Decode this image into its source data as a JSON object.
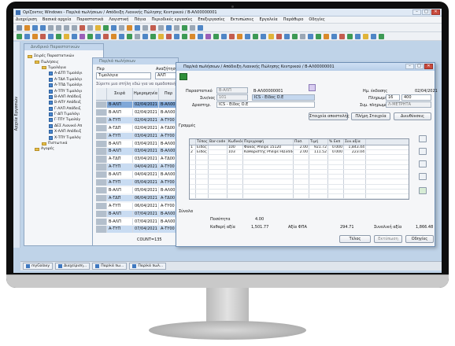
{
  "window": {
    "title": "Ορίζοντες Windows - Παρ/κά πωλήσεων / Απόδειξη Λιανικής Πώλησης Κεντρικού / Β-ΑΛ00000001"
  },
  "menu": [
    "Διαχείριση",
    "Βασικά αρχεία",
    "Παραστατικά",
    "Λογιστική",
    "Πάγια",
    "Περιοδικές εργασίες",
    "Επεξεργασίες",
    "Εκτυπώσεις",
    "Εργαλεία",
    "Παράθυρο",
    "Οδηγίες"
  ],
  "left_strip": {
    "label": "Αρχεία Εργασιών"
  },
  "tree_window": {
    "title": "Δενδρικό Παραστατικών",
    "items": [
      {
        "label": "Σειρές Παραστατικών",
        "level": 0,
        "type": "folder"
      },
      {
        "label": "Πωλήσεις",
        "level": 1,
        "type": "folder"
      },
      {
        "label": "Τιμολόγια",
        "level": 2,
        "type": "folder"
      },
      {
        "label": "Α-ΔΤΠ Τιμολόγι",
        "level": 3,
        "type": "doc"
      },
      {
        "label": "Α-ΤΔΑ Τιμολόγι",
        "level": 3,
        "type": "doc"
      },
      {
        "label": "Α-ΤΠΔ Τιμολόγι",
        "level": 3,
        "type": "doc"
      },
      {
        "label": "Α-ΤΠΥ Τιμολόγι",
        "level": 3,
        "type": "doc"
      },
      {
        "label": "Β-ΑΛΠ Απόδειξ",
        "level": 3,
        "type": "doc"
      },
      {
        "label": "Β-ΑΠΥ Απόδειξ",
        "level": 3,
        "type": "doc"
      },
      {
        "label": "Γ-ΑΛΠ Απόδειξ",
        "level": 3,
        "type": "doc"
      },
      {
        "label": "Γ-ΔΠ Τιμολόγι",
        "level": 3,
        "type": "doc"
      },
      {
        "label": "Γ-ΤΠΥ Τιμολόγ",
        "level": 3,
        "type": "doc"
      },
      {
        "label": "ΔΕΣ Λιανικό Απ",
        "level": 3,
        "type": "doc"
      },
      {
        "label": "Χ-ΑΛΠ Απόδειξ",
        "level": 3,
        "type": "doc"
      },
      {
        "label": "Χ-ΤΠΥ Τιμολόγ",
        "level": 3,
        "type": "doc"
      },
      {
        "label": "Πιστωτικά",
        "level": 2,
        "type": "folder"
      },
      {
        "label": "Αγορές",
        "level": 1,
        "type": "folder"
      }
    ]
  },
  "list_window": {
    "title": "Παρ/κά πωλήσεων",
    "type_label": "Περ",
    "type_value": "Τιμολόγια",
    "search_label": "Αναζήτηση",
    "search_value": "ΑΛΠ",
    "info_text": "Σύρετε μια στήλη εδώ για να ομαδοποιήσετε κατά...",
    "columns": [
      "Σειρά",
      "Ημερομηνία",
      "Παρ"
    ],
    "rows": [
      [
        "Β-ΑΛΠ",
        "02/04/2021",
        "Β-ΑΛ00"
      ],
      [
        "Β-ΑΛΠ",
        "02/04/2021",
        "Β-ΑΛ00"
      ],
      [
        "Α-ΤΥΠ",
        "02/04/2021",
        "Α-ΤΥ00"
      ],
      [
        "Α-ΤΔΠ",
        "02/04/2021",
        "Α-ΤΔ00"
      ],
      [
        "Α-ΤΥΠ",
        "03/04/2021",
        "Α-ΤΥ00"
      ],
      [
        "Β-ΑΛΠ",
        "03/04/2021",
        "Β-ΑΛ00"
      ],
      [
        "Β-ΑΛΠ",
        "03/04/2021",
        "Β-ΑΛ00"
      ],
      [
        "Α-ΤΔΠ",
        "03/04/2021",
        "Α-ΤΔ00"
      ],
      [
        "Α-ΤΥΠ",
        "04/04/2021",
        "Α-ΤΥ00"
      ],
      [
        "Β-ΑΛΠ",
        "04/04/2021",
        "Β-ΑΛ00"
      ],
      [
        "Α-ΤΥΠ",
        "05/04/2021",
        "Α-ΤΥ00"
      ],
      [
        "Β-ΑΛΠ",
        "05/04/2021",
        "Β-ΑΛ00"
      ],
      [
        "Α-ΤΔΠ",
        "06/04/2021",
        "Α-ΤΔ00"
      ],
      [
        "Α-ΤΥΠ",
        "06/04/2021",
        "Α-ΤΥ00"
      ],
      [
        "Β-ΑΛΠ",
        "07/04/2021",
        "Β-ΑΛ00"
      ],
      [
        "Β-ΑΛΠ",
        "07/04/2021",
        "Β-ΑΛ00"
      ],
      [
        "Α-ΤΥΠ",
        "07/04/2021",
        "Α-ΤΥ00"
      ]
    ],
    "count_text": "COUNT=135"
  },
  "invoice": {
    "title": "Παρ/κά πωλήσεων / Απόδειξη Λιανικής Πώλησης Κεντρικού / Β-ΑΛ00000001",
    "doc_label": "Παραστατικό",
    "doc_series": "Β-ΑΛΠ",
    "doc_number": "Β-ΑΛ00000001",
    "partner_label": "Συν/νος",
    "partner_code": "101",
    "partner_name": "ICS - Είδος Ο.Ε",
    "activity_label": "Δραστηρ.",
    "activity_value": "ICS - Είδος Ο.Ε",
    "date_label": "Ημ. έκδοσης",
    "date_value": "02/04/2021",
    "payment_label": "Πληρωμή",
    "payment_code": "16",
    "payment_value": "400",
    "seller_label": "Συμ. πληρωμής",
    "seller_value": "Λ-ΜΕΤΡΗΤΑ",
    "btn_delivery": "Στοιχεία αποστολής",
    "btn_extra": "Πλήρη Στοιχεία",
    "btn_more": "Διευθύνσεις",
    "lines_label": "Γραμμές",
    "columns": [
      "",
      "Τύπος",
      "Bar-code",
      "Κωδικός",
      "Περιγραφή",
      "Ποσ.",
      "Τιμή",
      "% Εκπ",
      "Συν.αξία"
    ],
    "lines": [
      [
        "1",
        "Είδος",
        "",
        "100",
        "Φακός Philips 15120",
        "2.00",
        "921.72",
        "0.000",
        "1,843.44"
      ],
      [
        "2",
        "Είδος",
        "",
        "103",
        "Καθαριστής Philips HD3444",
        "2.00",
        "111.52",
        "0.000",
        "223.04"
      ]
    ],
    "totals_label": "Σύνολα",
    "quantity_label": "Ποσότητα",
    "quantity_value": "4.00",
    "net_label": "Καθαρή αξία",
    "net_value": "1,501.77",
    "vat_label": "Αξία ΦΠΑ",
    "vat_value": "294.71",
    "total_label": "Συνολική αξία",
    "total_value": "1,866.48",
    "btn_ok": "Τέλος",
    "btn_print": "Εκτύπωση",
    "btn_help": "Οδηγίες"
  },
  "taskbar": [
    "myGalaxy",
    "Διαχείριση...",
    "Παρ/κά πω...",
    "Παρ/κά πωλ..."
  ]
}
